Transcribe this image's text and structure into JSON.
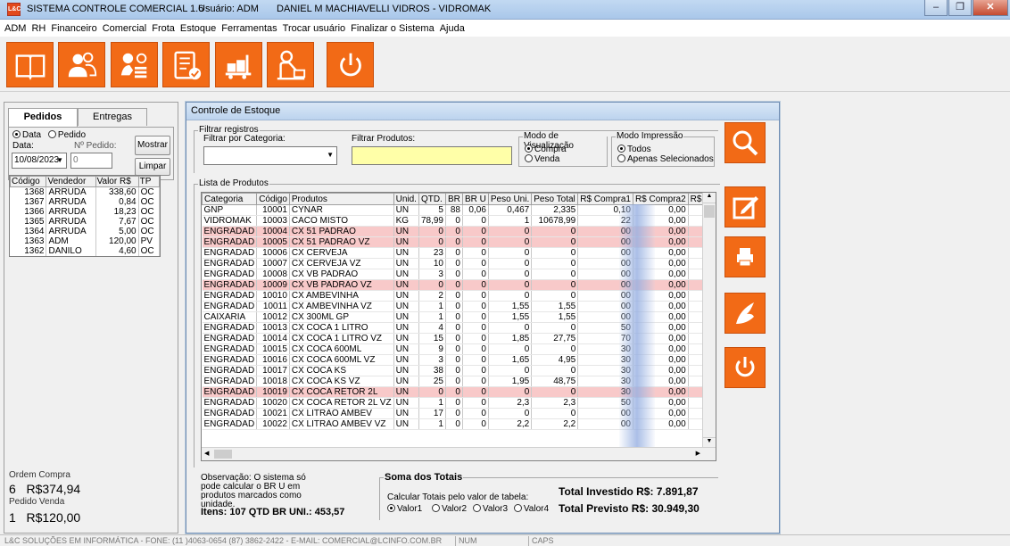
{
  "titlebar": {
    "app_title": "SISTEMA CONTROLE COMERCIAL 1.6",
    "user": "Usuário: ADM",
    "company": "DANIEL M MACHIAVELLI VIDROS - VIDROMAK",
    "icon_label": "L&C"
  },
  "menu": [
    "ADM",
    "RH",
    "Financeiro",
    "Comercial",
    "Frota",
    "Estoque",
    "Ferramentas",
    "Trocar usuário",
    "Finalizar o Sistema",
    "Ajuda"
  ],
  "toolbar": {
    "buttons": [
      "book-icon",
      "users-icon",
      "money-icon",
      "checklist-icon",
      "warehouse-icon",
      "receptionist-icon",
      "power-icon"
    ]
  },
  "left": {
    "tab_pedidos": "Pedidos",
    "tab_entregas": "Entregas",
    "radio_data": "Data",
    "radio_pedido": "Pedido",
    "label_data": "Data:",
    "label_npedido": "Nº Pedido:",
    "date_value": "10/08/2023",
    "npedido_value": "0",
    "btn_mostrar": "Mostrar",
    "btn_limpar": "Limpar",
    "headers": [
      "Código",
      "Vendedor",
      "Valor R$",
      "TP"
    ],
    "rows": [
      [
        "1368",
        "ARRUDA",
        "338,60",
        "OC"
      ],
      [
        "1367",
        "ARRUDA",
        "0,84",
        "OC"
      ],
      [
        "1366",
        "ARRUDA",
        "18,23",
        "OC"
      ],
      [
        "1365",
        "ARRUDA",
        "7,67",
        "OC"
      ],
      [
        "1364",
        "ARRUDA",
        "5,00",
        "OC"
      ],
      [
        "1363",
        "ADM",
        "120,00",
        "PV"
      ],
      [
        "1362",
        "DANILO",
        "4,60",
        "OC"
      ]
    ],
    "ordem_compra_label": "Ordem Compra",
    "ordem_compra_count": "6",
    "ordem_compra_total": "R$374,94",
    "pedido_venda_label": "Pedido Venda",
    "pedido_venda_count": "1",
    "pedido_venda_total": "R$120,00"
  },
  "main": {
    "caption": "Controle de Estoque",
    "filtrar_registros": "Filtrar registros",
    "filtrar_categoria": "Filtrar por Categoria:",
    "filtrar_produtos": "Filtrar Produtos:",
    "modo_visualizacao": "Modo de Visualização",
    "vis_compra": "Compra",
    "vis_venda": "Venda",
    "modo_impressao": "Modo Impressão",
    "imp_todos": "Todos",
    "imp_apenas": "Apenas Selecionados",
    "lista_produtos": "Lista de Produtos",
    "headers": [
      "Categoria",
      "Código",
      "Produtos",
      "Unid.",
      "QTD.",
      "BR",
      "BR U",
      "Peso Uni.",
      "Peso Total",
      "R$ Compra1",
      "R$ Compra2",
      "R$"
    ],
    "rows": [
      [
        "GNP",
        "10001",
        "CYNAR",
        "UN",
        "5",
        "88",
        "0,06",
        "0,467",
        "2,335",
        "0,10",
        "0,00",
        ""
      ],
      [
        "VIDROMAK",
        "10003",
        "CACO MISTO",
        "KG",
        "78,99",
        "0",
        "0",
        "1",
        "10678,99",
        "22",
        "0,00",
        ""
      ],
      [
        "ENGRADAD",
        "10004",
        "CX 51 PADRÃO",
        "UN",
        "0",
        "0",
        "0",
        "0",
        "0",
        "00",
        "0,00",
        ""
      ],
      [
        "ENGRADAD",
        "10005",
        "CX 51 PADRÃO VZ",
        "UN",
        "0",
        "0",
        "0",
        "0",
        "0",
        "00",
        "0,00",
        ""
      ],
      [
        "ENGRADAD",
        "10006",
        "CX CERVEJA",
        "UN",
        "23",
        "0",
        "0",
        "0",
        "0",
        "00",
        "0,00",
        ""
      ],
      [
        "ENGRADAD",
        "10007",
        "CX CERVEJA VZ",
        "UN",
        "10",
        "0",
        "0",
        "0",
        "0",
        "00",
        "0,00",
        ""
      ],
      [
        "ENGRADAD",
        "10008",
        "CX VB PADRÃO",
        "UN",
        "3",
        "0",
        "0",
        "0",
        "0",
        "00",
        "0,00",
        ""
      ],
      [
        "ENGRADAD",
        "10009",
        "CX VB PADRÃO VZ",
        "UN",
        "0",
        "0",
        "0",
        "0",
        "0",
        "00",
        "0,00",
        ""
      ],
      [
        "ENGRADAD",
        "10010",
        "CX AMBEVINHA",
        "UN",
        "2",
        "0",
        "0",
        "0",
        "0",
        "00",
        "0,00",
        ""
      ],
      [
        "ENGRADAD",
        "10011",
        "CX AMBEVINHA VZ",
        "UN",
        "1",
        "0",
        "0",
        "1,55",
        "1,55",
        "00",
        "0,00",
        ""
      ],
      [
        "CAIXARIA",
        "10012",
        "CX 300ML GP",
        "UN",
        "1",
        "0",
        "0",
        "1,55",
        "1,55",
        "00",
        "0,00",
        ""
      ],
      [
        "ENGRADAD",
        "10013",
        "CX COCA 1 LITRO",
        "UN",
        "4",
        "0",
        "0",
        "0",
        "0",
        "50",
        "0,00",
        ""
      ],
      [
        "ENGRADAD",
        "10014",
        "CX COCA 1 LITRO VZ",
        "UN",
        "15",
        "0",
        "0",
        "1,85",
        "27,75",
        "70",
        "0,00",
        ""
      ],
      [
        "ENGRADAD",
        "10015",
        "CX COCA 600ML",
        "UN",
        "9",
        "0",
        "0",
        "0",
        "0",
        "30",
        "0,00",
        ""
      ],
      [
        "ENGRADAD",
        "10016",
        "CX COCA 600ML VZ",
        "UN",
        "3",
        "0",
        "0",
        "1,65",
        "4,95",
        "30",
        "0,00",
        ""
      ],
      [
        "ENGRADAD",
        "10017",
        "CX COCA KS",
        "UN",
        "38",
        "0",
        "0",
        "0",
        "0",
        "30",
        "0,00",
        ""
      ],
      [
        "ENGRADAD",
        "10018",
        "CX COCA KS VZ",
        "UN",
        "25",
        "0",
        "0",
        "1,95",
        "48,75",
        "30",
        "0,00",
        ""
      ],
      [
        "ENGRADAD",
        "10019",
        "CX COCA RETOR 2L",
        "UN",
        "0",
        "0",
        "0",
        "0",
        "0",
        "30",
        "0,00",
        ""
      ],
      [
        "ENGRADAD",
        "10020",
        "CX COCA RETOR 2L VZ",
        "UN",
        "1",
        "0",
        "0",
        "2,3",
        "2,3",
        "50",
        "0,00",
        ""
      ],
      [
        "ENGRADAD",
        "10021",
        "CX LITRÃO AMBEV",
        "UN",
        "17",
        "0",
        "0",
        "0",
        "0",
        "00",
        "0,00",
        ""
      ],
      [
        "ENGRADAD",
        "10022",
        "CX LITRÃO AMBEV VZ",
        "UN",
        "1",
        "0",
        "0",
        "2,2",
        "2,2",
        "00",
        "0,00",
        ""
      ]
    ],
    "pink_rows": [
      2,
      3,
      7,
      17
    ],
    "observacao": "Observação: O sistema só pode calcular o BR U em produtos marcados como unidade.",
    "itens_summary": "Itens: 107  QTD BR UNI.:  453,57",
    "soma_totais": "Soma dos Totais",
    "calcular_label": "Calcular Totais pelo valor de tabela:",
    "valor_options": [
      "Valor1",
      "Valor2",
      "Valor3",
      "Valor4"
    ],
    "total_investido": "Total Investido R$:  7.891,87",
    "total_previsto": "Total Previsto R$:  30.949,30"
  },
  "side_buttons": [
    "search-icon",
    "edit-icon",
    "print-icon",
    "quill-icon",
    "power-icon"
  ],
  "status": {
    "company": "L&C SOLUÇÕES EM INFORMÁTICA - FONE: (11 )4063-0654  (87) 3862-2422 - E-MAIL: COMERCIAL@LCINFO.COM.BR",
    "num": "NUM",
    "caps": "CAPS"
  },
  "colors": {
    "accent": "#f26a16",
    "pink_row": "#f8c9c9",
    "produto_filter_bg": "#ffffa8"
  }
}
